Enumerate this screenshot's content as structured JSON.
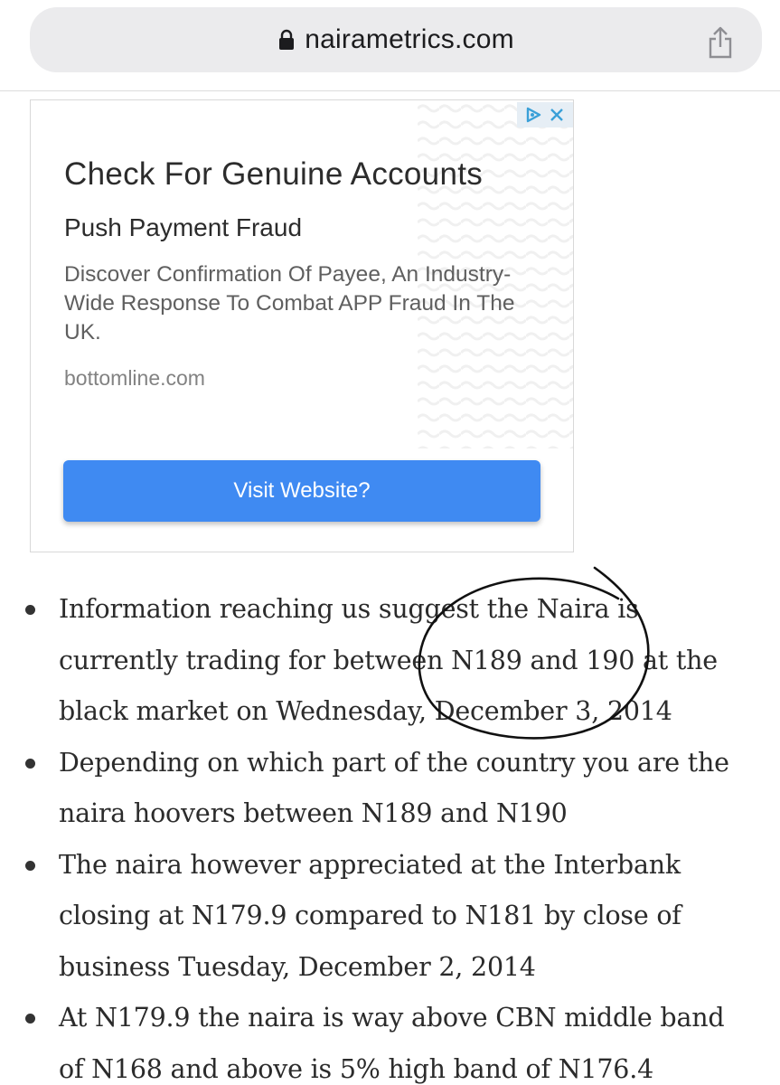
{
  "browser": {
    "url": "nairametrics.com",
    "icons": {
      "lock": "lock-icon",
      "share": "share-icon"
    }
  },
  "ad": {
    "title": "Check For Genuine Accounts",
    "subtitle": "Push Payment Fraud",
    "description": "Discover Confirmation Of Payee, An Industry-Wide Response To Combat APP Fraud In The UK.",
    "domain": "bottomline.com",
    "button_label": "Visit Website?",
    "icons": {
      "adchoices": "adchoices-icon",
      "close": "close-icon"
    },
    "colors": {
      "button": "#3f8af2",
      "adchoices_bg": "#e6eef5",
      "adchoices_icon": "#3aa0d8"
    }
  },
  "article": {
    "bullets": [
      "Information reaching us suggest the Naira is currently trading for between N189 and 190 at the black market on Wednesday, December 3, 2014",
      "Depending on which part of the country you are the naira hoovers between N189 and N190",
      "The naira however appreciated at the Interbank closing at N179.9 compared to N181 by close of business Tuesday, December 2, 2014",
      "At N179.9 the naira is way above CBN middle band of N168 and above is 5% high band of N176.4"
    ]
  },
  "annotation": {
    "shape": "hand-drawn circle",
    "color": "#111111"
  }
}
